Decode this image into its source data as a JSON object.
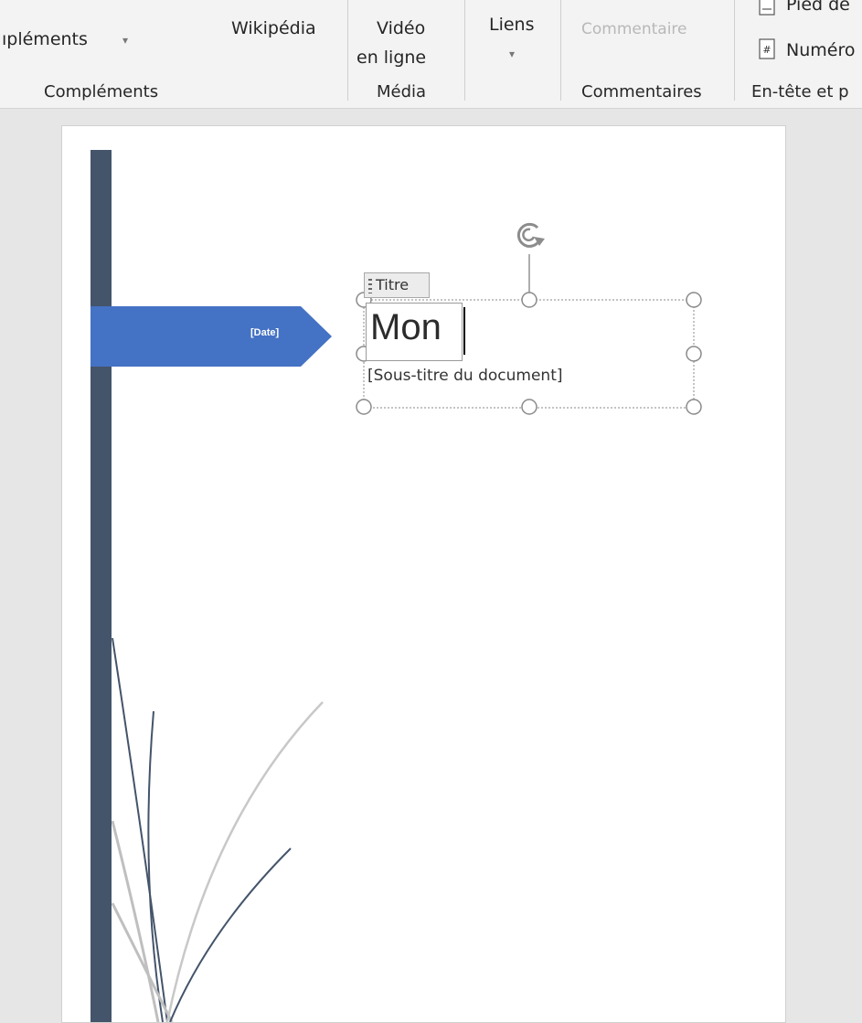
{
  "ribbon": {
    "complements_label": "ıpléments",
    "wikipedia_label": "Wikipédia",
    "video_line1": "Vidéo",
    "video_line2": "en ligne",
    "links_label": "Liens",
    "comment_label": "Commentaire",
    "footer_label": "Pied de",
    "number_label": "Numéro",
    "groups": {
      "complements": "Compléments",
      "media": "Média",
      "comments": "Commentaires",
      "header_footer": "En-tête et p"
    }
  },
  "document": {
    "date_placeholder": "[Date]",
    "title_tag": "Titre",
    "title_text": "Mon",
    "subtitle_placeholder": "[Sous-titre du document]"
  },
  "colors": {
    "sidebar": "#44546a",
    "date_banner": "#4472c4",
    "ribbon_bg": "#f3f3f3"
  }
}
